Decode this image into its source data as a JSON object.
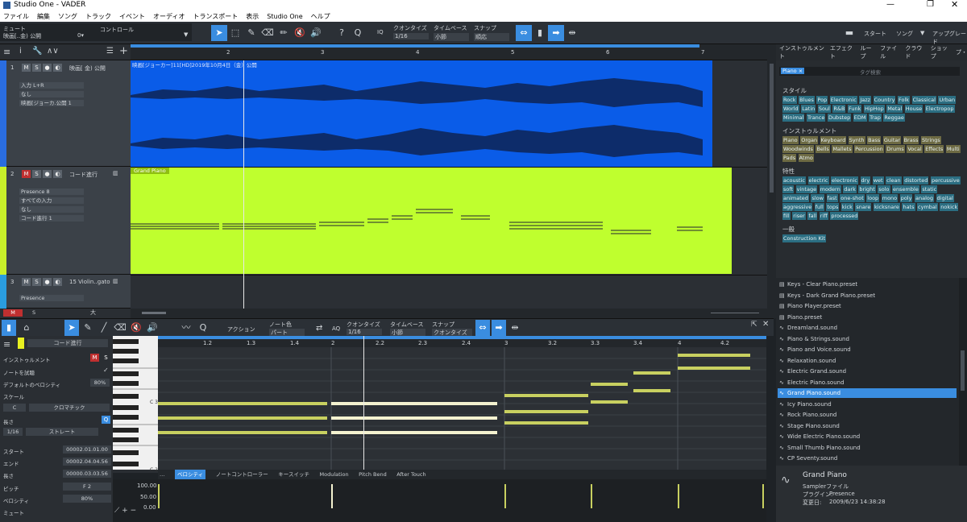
{
  "window": {
    "title": "Studio One - VADER"
  },
  "menu": [
    "ファイル",
    "編集",
    "ソング",
    "トラック",
    "イベント",
    "オーディオ",
    "トランスポート",
    "表示",
    "Studio One",
    "ヘルプ"
  ],
  "toolbar": {
    "mute_label": "ミュート",
    "track_label": "映画[..金) 公開",
    "zero_label": "0▾",
    "control_label": "コントロール",
    "iq_label": "IQ",
    "quantize_label": "クオンタイズ",
    "quantize_value": "1/16",
    "timebase_label": "タイムベース",
    "timebase_value": "小節",
    "snap_label": "スナップ",
    "snap_value": "順応",
    "start_label": "スタート",
    "song_label": "ソング",
    "update_label": "アップグレード"
  },
  "ruler_top": [
    "2",
    "3",
    "4",
    "5",
    "6",
    "7"
  ],
  "tracks": [
    {
      "num": "1",
      "name": "映画[ 金) 公開",
      "input": "入力 L+R",
      "out1": "なし",
      "out2": "映画[ジョーカ.公開 1",
      "audio_label": "映画[ジョーカー]11[HD]2019年10月4日（金）公開"
    },
    {
      "num": "2",
      "name": "コード進行",
      "preset": "Presence 8",
      "input": "すべての入力",
      "out1": "なし",
      "out2": "コード進行 1",
      "event_label": "Grand Piano"
    },
    {
      "num": "3",
      "name": "15 Violin..gato",
      "preset": "Presence"
    }
  ],
  "browser": {
    "tabs": [
      "インストゥルメント",
      "エフェクト",
      "ループ",
      "ファイル",
      "クラウド",
      "ショップ",
      "プ・"
    ],
    "filter_tag": "Piano ×",
    "search_placeholder": "タグ検索",
    "style_title": "スタイル",
    "style_tags": [
      "Rock",
      "Blues",
      "Pop",
      "Electronic",
      "Jazz",
      "Country",
      "Folk",
      "Classical",
      "Urban",
      "World",
      "Latin",
      "Soul",
      "R&B",
      "Funk",
      "HipHop",
      "Metal",
      "House",
      "Electropop",
      "Minimal",
      "Trance",
      "Dubstep",
      "EDM",
      "Trap",
      "Reggae"
    ],
    "instrument_title": "インストゥルメント",
    "instrument_tags": [
      "Piano",
      "Organ",
      "Keyboard",
      "Synth",
      "Bass",
      "Guitar",
      "Brass",
      "Strings",
      "Woodwinds",
      "Bells",
      "Mallets",
      "Percussion",
      "Drums",
      "Vocal",
      "Effects",
      "Multi",
      "Pads",
      "Atmo"
    ],
    "attr_title": "特性",
    "attr_tags": [
      "acoustic",
      "electric",
      "electronic",
      "dry",
      "wet",
      "clean",
      "distorted",
      "percussive",
      "soft",
      "vintage",
      "modern",
      "dark",
      "bright",
      "solo",
      "ensemble",
      "static",
      "animated",
      "slow",
      "fast",
      "one-shot",
      "loop",
      "mono",
      "poly",
      "analog",
      "digital",
      "aggressive",
      "full",
      "tops",
      "kick",
      "snare",
      "kicksnare",
      "hats",
      "cymbal",
      "nokick",
      "fill",
      "riser",
      "fall",
      "riff",
      "processed"
    ],
    "general_title": "一般",
    "general_tags": [
      "Construction Kit"
    ]
  },
  "files": [
    "Keys - Clear Piano.preset",
    "Keys - Dark Grand Piano.preset",
    "Piano Player.preset",
    "Piano.preset",
    "Dreamland.sound",
    "Piano & Strings.sound",
    "Piano and Voice.sound",
    "Relaxation.sound",
    "Electric Grand.sound",
    "Electric Piano.sound",
    "Grand Piano.sound",
    "Icy Piano.sound",
    "Rock Piano.sound",
    "Stage Piano.sound",
    "Wide Electric Piano.sound",
    "Small Thumb Piano.sound",
    "CP Seventy.sound"
  ],
  "info": {
    "name": "Grand Piano",
    "type": "Samplerファイル",
    "plugin_label": "プラグイン:",
    "plugin": "Presence",
    "date_label": "変更日:",
    "date": "2009/6/23 14:38:28"
  },
  "editor": {
    "action_label": "アクション",
    "note_color_label": "ノート色",
    "note_color_value": "パート",
    "aq": "AQ",
    "quantize_label": "クオンタイズ",
    "quantize_value": "1/16",
    "timebase_label": "タイムベース",
    "timebase_value": "小節",
    "snap_label": "スナップ",
    "snap_value": "クオンタイズ",
    "track_name": "コード進行",
    "instrument_label": "インストゥルメント",
    "audition_label": "ノートを試聴",
    "default_vel_label": "デフォルトのベロシティ",
    "default_vel": "80%",
    "scale_label": "スケール",
    "scale_key": "C",
    "scale_type": "クロマチック",
    "length_label": "長さ",
    "length_value": "1/16",
    "length_mode": "ストレート",
    "start_label": "スタート",
    "start_value": "00002.01.01.00",
    "end_label": "エンド",
    "end_value": "00002.04.04.56",
    "len2_label": "長さ",
    "len2_value": "00000.03.03.56",
    "pitch_label": "ピッチ",
    "pitch_value": "F 2",
    "velocity_label": "ベロシティ",
    "velocity_value": "80%",
    "mute_label": "ミュート",
    "c3": "C 3",
    "c2": "C 2",
    "velocity_tabs": [
      "ベロシティ",
      "ノートコントローラー",
      "キースイッチ",
      "Modulation",
      "Pitch Bend",
      "After Touch"
    ],
    "vel_scale": [
      "100.00",
      "50.00",
      "0.00"
    ]
  },
  "ruler_edit": [
    "1.2",
    "1.3",
    "1.4",
    "2",
    "2.2",
    "2.3",
    "2.4",
    "3",
    "3.2",
    "3.3",
    "3.4",
    "4",
    "4.2"
  ],
  "colors": {
    "accent": "#3a8de0",
    "audio_event": "#0a5ce8",
    "instrument_event": "#bfff2e",
    "note": "#c8d060"
  }
}
